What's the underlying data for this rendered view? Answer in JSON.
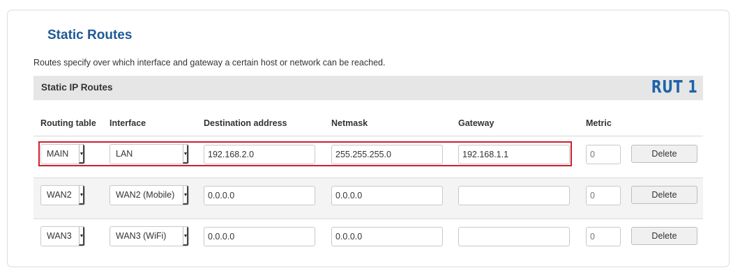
{
  "page": {
    "title": "Static Routes",
    "description": "Routes specify over which interface and gateway a certain host or network can be reached."
  },
  "section": {
    "title": "Static IP Routes",
    "brand": "RUT 1"
  },
  "table": {
    "headers": [
      "Routing table",
      "Interface",
      "Destination address",
      "Netmask",
      "Gateway",
      "Metric"
    ],
    "rows": [
      {
        "routing_table": "MAIN",
        "interface": "LAN",
        "destination": "192.168.2.0",
        "netmask": "255.255.255.0",
        "gateway": "192.168.1.1",
        "metric_placeholder": "0",
        "delete_label": "Delete",
        "highlighted": true
      },
      {
        "routing_table": "WAN2",
        "interface": "WAN2 (Mobile)",
        "destination": "0.0.0.0",
        "netmask": "0.0.0.0",
        "gateway": "",
        "metric_placeholder": "0",
        "delete_label": "Delete",
        "highlighted": false
      },
      {
        "routing_table": "WAN3",
        "interface": "WAN3 (WiFi)",
        "destination": "0.0.0.0",
        "netmask": "0.0.0.0",
        "gateway": "",
        "metric_placeholder": "0",
        "delete_label": "Delete",
        "highlighted": false
      }
    ]
  },
  "colors": {
    "title": "#1f5a98",
    "brand": "#1e64a8",
    "highlight_border": "#cc1f2e",
    "section_bar": "#e6e6e6"
  },
  "icons": {
    "select_arrow": "caret-down-icon"
  }
}
